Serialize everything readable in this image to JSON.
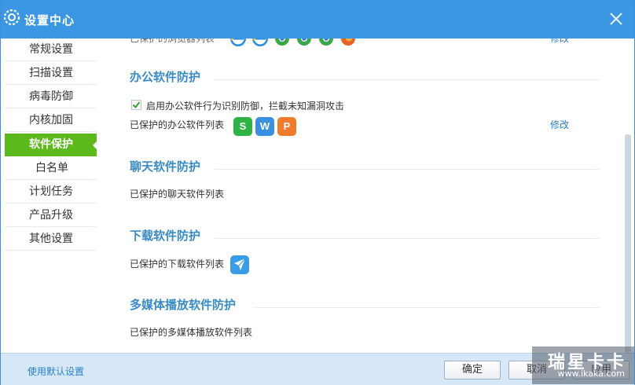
{
  "window": {
    "title": "设置中心",
    "close_icon": "close-icon"
  },
  "sidebar": {
    "items": [
      {
        "label": "常规设置"
      },
      {
        "label": "扫描设置"
      },
      {
        "label": "病毒防御"
      },
      {
        "label": "内核加固"
      },
      {
        "label": "软件保护",
        "active": true
      },
      {
        "label": "白名单"
      },
      {
        "label": "计划任务"
      },
      {
        "label": "产品升级"
      },
      {
        "label": "其他设置"
      }
    ]
  },
  "browser_section": {
    "partial_label": "已保护的浏览器列表",
    "modify_link": "修改",
    "icons": [
      "ie-icon",
      "ie-icon",
      "chrome-icon",
      "chrome-icon",
      "chrome-icon",
      "firefox-icon"
    ]
  },
  "office_section": {
    "title": "办公软件防护",
    "checkbox_label": "启用办公软件行为识别防御，拦截未知漏洞攻击",
    "checkbox_checked": true,
    "list_label": "已保护的办公软件列表",
    "modify_link": "修改",
    "apps": [
      {
        "letter": "S",
        "color": "#2fb344",
        "icon": "wps-spreadsheet-icon"
      },
      {
        "letter": "W",
        "color": "#3a8fe0",
        "icon": "wps-writer-icon"
      },
      {
        "letter": "P",
        "color": "#f07b2a",
        "icon": "wps-presentation-icon"
      }
    ]
  },
  "chat_section": {
    "title": "聊天软件防护",
    "list_label": "已保护的聊天软件列表"
  },
  "download_section": {
    "title": "下载软件防护",
    "list_label": "已保护的下载软件列表",
    "apps": [
      {
        "icon": "thunder-download-icon",
        "color": "#3a9be6"
      }
    ]
  },
  "media_section": {
    "title": "多媒体播放软件防护",
    "list_label": "已保护的多媒体播放软件列表"
  },
  "footer": {
    "default_link": "使用默认设置",
    "ok_label": "确定",
    "cancel_label": "取消",
    "apply_label": "应用"
  },
  "watermark": {
    "text": "瑞星卡卡",
    "url": "www.ikaka.com"
  },
  "colors": {
    "titlebar": "#3b97e3",
    "active_nav": "#5cb91c",
    "section_title": "#3a8ac6",
    "link": "#2a7fc8"
  }
}
